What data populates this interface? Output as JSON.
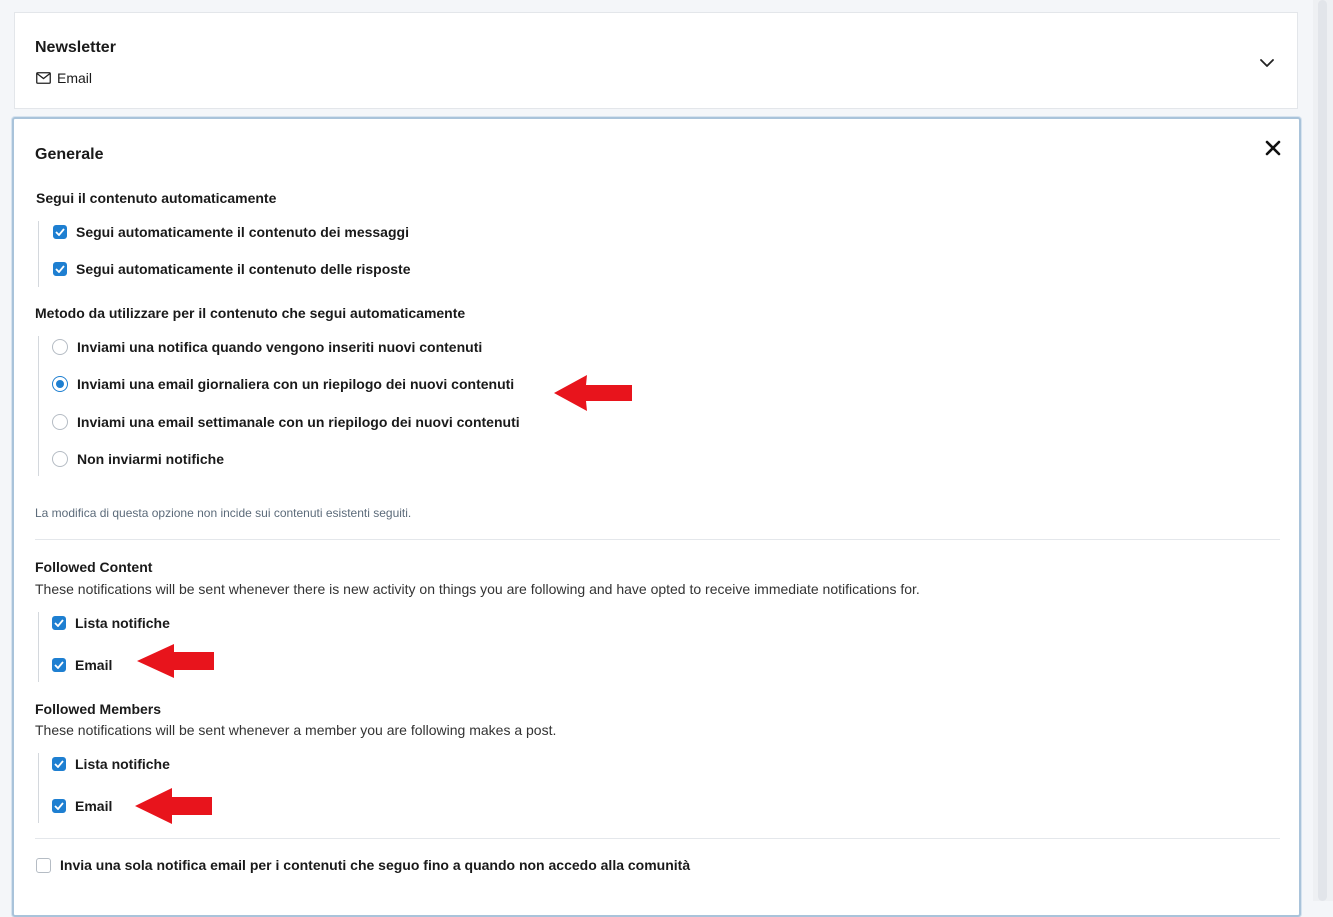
{
  "newsletter": {
    "title": "Newsletter",
    "channel_label": "Email",
    "channel_icon": "envelope-icon",
    "toggle_icon": "chevron-down-icon"
  },
  "general": {
    "title": "Generale",
    "close_icon": "close-icon",
    "auto_follow": {
      "heading": "Segui il contenuto automaticamente",
      "options": [
        {
          "label": "Segui automaticamente il contenuto dei messaggi",
          "checked": true
        },
        {
          "label": "Segui automaticamente il contenuto delle risposte",
          "checked": true
        }
      ]
    },
    "method": {
      "heading": "Metodo da utilizzare per il contenuto che segui automaticamente",
      "options": [
        {
          "label": "Inviami una notifica quando vengono inseriti nuovi contenuti",
          "selected": false
        },
        {
          "label": "Inviami una email giornaliera con un riepilogo dei nuovi contenuti",
          "selected": true
        },
        {
          "label": "Inviami una email settimanale con un riepilogo dei nuovi contenuti",
          "selected": false
        },
        {
          "label": "Non inviarmi notifiche",
          "selected": false
        }
      ],
      "note": "La modifica di questa opzione non incide sui contenuti esistenti seguiti."
    },
    "followed_content": {
      "heading": "Followed Content",
      "description": "These notifications will be sent whenever there is new activity on things you are following and have opted to receive immediate notifications for.",
      "options": [
        {
          "label": "Lista notifiche",
          "checked": true
        },
        {
          "label": "Email",
          "checked": true
        }
      ]
    },
    "followed_members": {
      "heading": "Followed Members",
      "description": "These notifications will be sent whenever a member you are following makes a post.",
      "options": [
        {
          "label": "Lista notifiche",
          "checked": true
        },
        {
          "label": "Email",
          "checked": true
        }
      ]
    },
    "single_email": {
      "label": "Invia una sola notifica email per i contenuti che seguo fino a quando non accedo alla comunità",
      "checked": false
    }
  },
  "colors": {
    "accent": "#1e7fd1",
    "annotation_arrow": "#e8141c"
  }
}
